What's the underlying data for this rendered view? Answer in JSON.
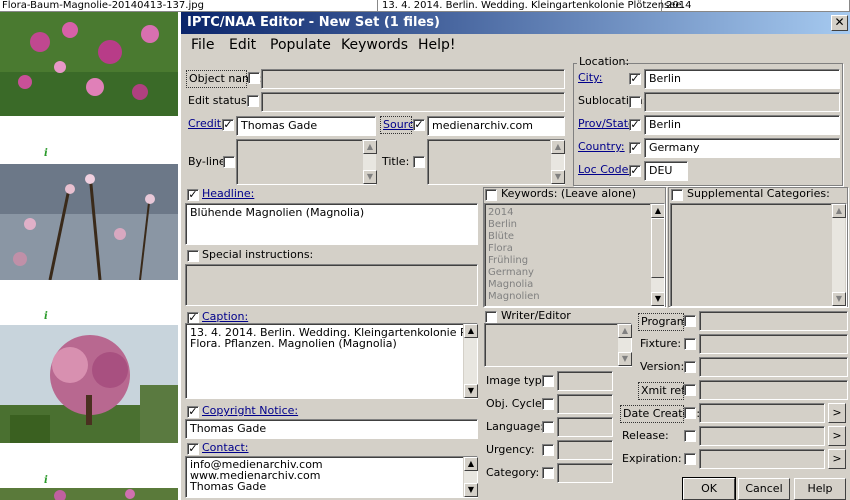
{
  "background": {
    "columns": [
      "Flora-Baum-Magnolie-20140413-137.jpg",
      "13. 4. 2014. Berlin. Wedding. Kleingartenkolonie Plötzensee.",
      "2014"
    ],
    "thumb_badge": "i"
  },
  "dialog": {
    "title": "IPTC/NAA Editor - New Set (1 files)",
    "close": "✕",
    "menu": [
      "File",
      "Edit",
      "Populate",
      "Keywords",
      "Help!"
    ]
  },
  "fields": {
    "object_name": {
      "label": "Object name:",
      "value": ""
    },
    "edit_status": {
      "label": "Edit status:",
      "value": ""
    },
    "credit": {
      "label": "Credit:",
      "value": "Thomas Gade"
    },
    "source": {
      "label": "Source",
      "value": "medienarchiv.com"
    },
    "byline": {
      "label": "By-line:"
    },
    "title": {
      "label": "Title:"
    },
    "location_group": "Location:",
    "city": {
      "label": "City:",
      "value": "Berlin"
    },
    "sublocation": {
      "label": "Sublocation:",
      "value": ""
    },
    "prov_state": {
      "label": "Prov/State:",
      "value": "Berlin"
    },
    "country": {
      "label": "Country:",
      "value": "Germany"
    },
    "loc_code": {
      "label": "Loc Code:",
      "value": "DEU"
    },
    "headline": {
      "label": "Headline:",
      "value": "Blühende Magnolien (Magnolia)"
    },
    "special_instructions": {
      "label": "Special instructions:"
    },
    "caption": {
      "label": "Caption:",
      "line1": "13. 4. 2014. Berlin. Wedding. Kleingartenkolonie Plötzensee.",
      "line2": "Flora. Pflanzen. Magnolien (Magnolia)"
    },
    "copyright": {
      "label": "Copyright Notice:",
      "value": "Thomas Gade"
    },
    "contact": {
      "label": "Contact:",
      "lines": [
        "info@medienarchiv.com",
        "www.medienarchiv.com",
        "Thomas Gade"
      ]
    },
    "keywords": {
      "label": "Keywords: (Leave alone)",
      "items": [
        "2014",
        "Berlin",
        "Blüte",
        "Flora",
        "Frühling",
        "Germany",
        "Magnolia",
        "Magnolien"
      ]
    },
    "supplemental": {
      "label": "Supplemental Categories:"
    },
    "writer": {
      "label": "Writer/Editor"
    },
    "image_type": {
      "label": "Image type:"
    },
    "obj_cycle": {
      "label": "Obj. Cycle:"
    },
    "language": {
      "label": "Language:"
    },
    "urgency": {
      "label": "Urgency:"
    },
    "category": {
      "label": "Category:"
    },
    "program": {
      "label": "Program:"
    },
    "fixture": {
      "label": "Fixture:"
    },
    "version": {
      "label": "Version:"
    },
    "xmit_ref": {
      "label": "Xmit ref:"
    },
    "date_created": {
      "label": "Date Created:"
    },
    "release": {
      "label": "Release:"
    },
    "expiration": {
      "label": "Expiration:"
    }
  },
  "buttons": {
    "ok": "OK",
    "cancel": "Cancel",
    "help": "Help",
    "arrow": ">"
  },
  "scroll": {
    "up": "▲",
    "down": "▼"
  },
  "check": "✓",
  "colors": {
    "title_start": "#0a246a",
    "title_end": "#a6caf0",
    "dialog_bg": "#d4d0c8",
    "label_link": "#00008b",
    "badge": "#2a9a2a"
  }
}
